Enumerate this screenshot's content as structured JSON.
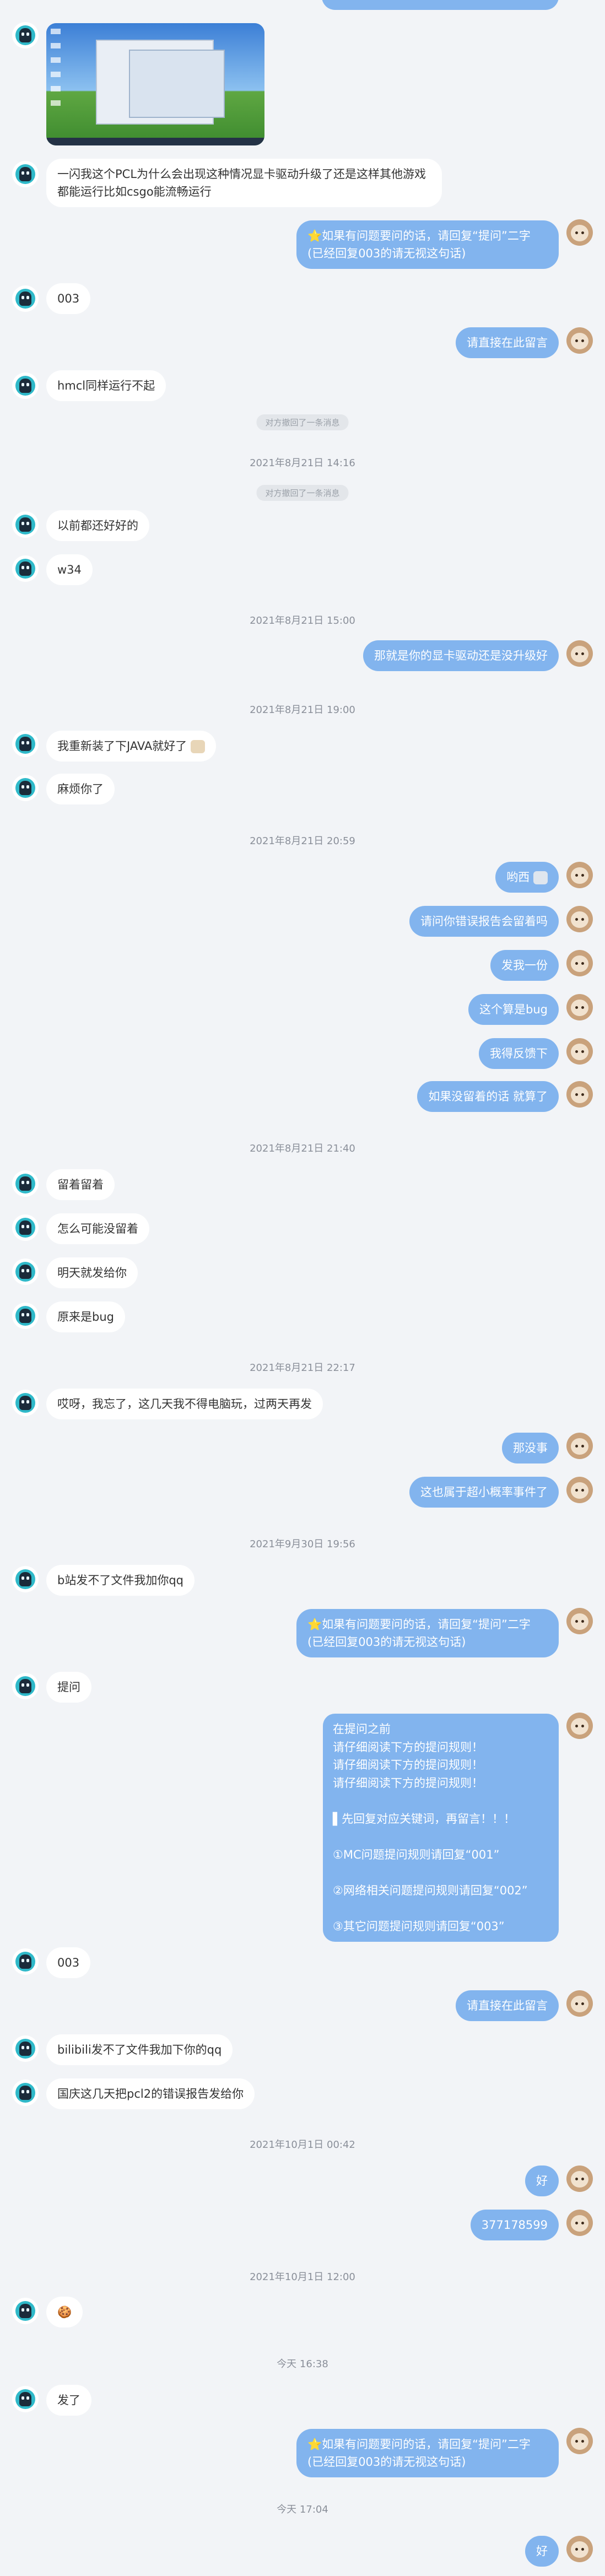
{
  "messages": {
    "m1": "一闪我这个PCL为什么会出现这种情况显卡驱动升级了还是这样其他游戏\n都能运行比如csgo能流畅运行",
    "m2": "⭐如果有问题要问的话，请回复“提问”二字\n(已经回复003的请无视这句话)",
    "m3": "003",
    "m4": "请直接在此留言",
    "m5": "hmcl同样运行不起",
    "recall1": "对方撤回了一条消息",
    "t1": "2021年8月21日 14:16",
    "recall2": "对方撤回了一条消息",
    "m6": "以前都还好好的",
    "m7": "w34",
    "t2": "2021年8月21日 15:00",
    "m8": "那就是你的显卡驱动还是没升级好",
    "t3": "2021年8月21日 19:00",
    "m9": "我重新装了下JAVA就好了",
    "m10": "麻烦你了",
    "t4": "2021年8月21日 20:59",
    "m11": "哟西",
    "m12": "请问你错误报告会留着吗",
    "m13": "发我一份",
    "m14": "这个算是bug",
    "m15": "我得反馈下",
    "m16": "如果没留着的话 就算了",
    "t5": "2021年8月21日 21:40",
    "m17": "留着留着",
    "m18": "怎么可能没留着",
    "m19": "明天就发给你",
    "m20": "原来是bug",
    "t6": "2021年8月21日 22:17",
    "m21": "哎呀，我忘了，这几天我不得电脑玩，过两天再发",
    "m22": "那没事",
    "m23": "这也属于超小概率事件了",
    "t7": "2021年9月30日 19:56",
    "m24": "b站发不了文件我加你qq",
    "m25": "⭐如果有问题要问的话，请回复“提问”二字\n(已经回复003的请无视这句话)",
    "m26": "提问",
    "m27": "在提问之前\n请仔细阅读下方的提问规则！\n请仔细阅读下方的提问规则！\n请仔细阅读下方的提问规则！\n\n▌先回复对应关键词，再留言！！！\n\n①MC问题提问规则请回复“001”\n\n②网络相关问题提问规则请回复“002”\n\n③其它问题提问规则请回复“003”",
    "m28": "003",
    "m29": "请直接在此留言",
    "m30": "bilibili发不了文件我加下你的qq",
    "m31": "国庆这几天把pcl2的错误报告发给你",
    "t8": "2021年10月1日 00:42",
    "m32": "好",
    "m33": "377178599",
    "t9": "2021年10月1日 12:00",
    "m34": "🍪",
    "t10": "今天 16:38",
    "m35": "发了",
    "m36": "⭐如果有问题要问的话，请回复“提问”二字\n(已经回复003的请无视这句话)",
    "t11": "今天 17:04",
    "m37": "好"
  },
  "colors": {
    "background": "#f2f4f7",
    "incoming_bubble": "#ffffff",
    "outgoing_bubble": "#82b4ee"
  }
}
